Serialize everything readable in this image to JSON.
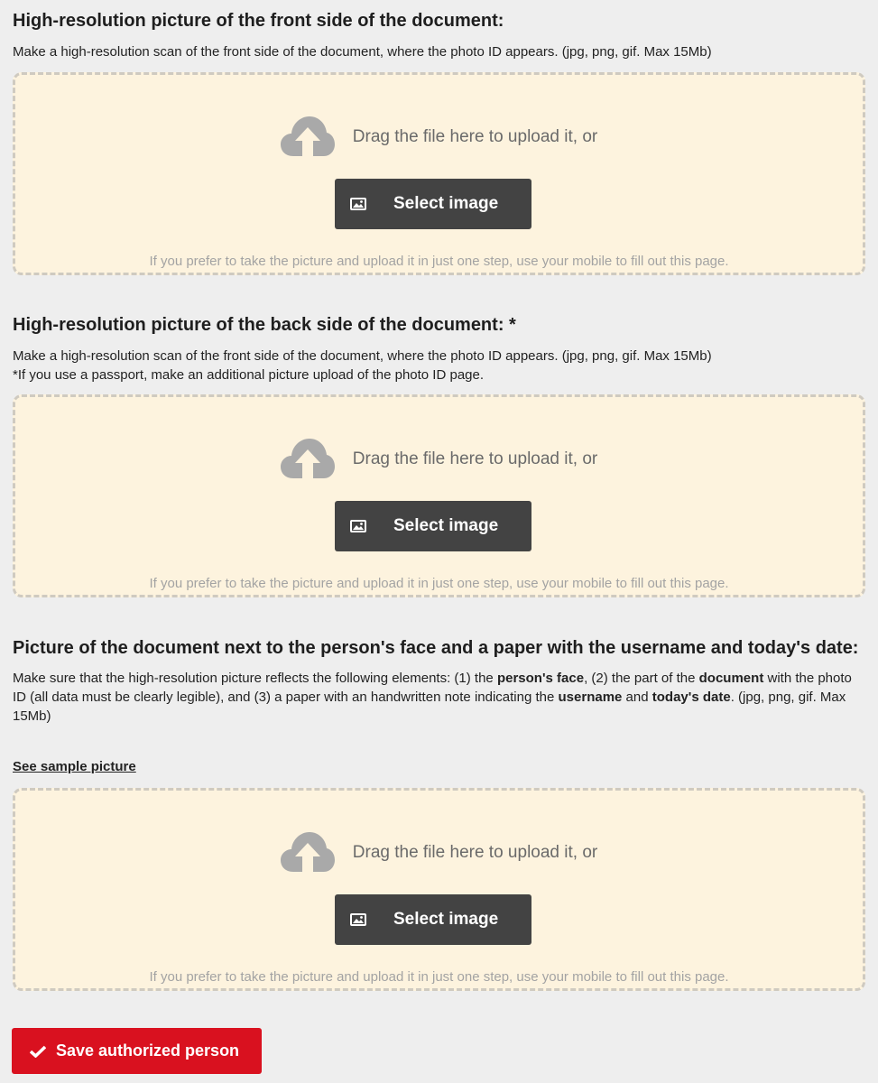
{
  "sections": [
    {
      "title": "High-resolution picture of the front side of the document:",
      "desc": "Make a high-resolution scan of the front side of the document, where the photo ID appears. (jpg, png, gif. Max 15Mb)"
    },
    {
      "title": "High-resolution picture of the back side of the document: *",
      "desc": "Make a high-resolution scan of the front side of the document, where the photo ID appears. (jpg, png, gif. Max 15Mb)",
      "note": "*If you use a passport, make an additional picture upload of the photo ID page."
    },
    {
      "title": "Picture of the document next to the person's face and a paper with the username and today's date:",
      "desc_parts": [
        {
          "text": "Make sure that the high-resolution picture reflects the following elements: (1) the ",
          "bold": false
        },
        {
          "text": "person's face",
          "bold": true
        },
        {
          "text": ", (2) the part of the ",
          "bold": false
        },
        {
          "text": "document",
          "bold": true
        },
        {
          "text": " with the photo ID (all data must be clearly legible), and (3) a paper with an handwritten note indicating the ",
          "bold": false
        },
        {
          "text": "username",
          "bold": true
        },
        {
          "text": " and ",
          "bold": false
        },
        {
          "text": "today's date",
          "bold": true
        },
        {
          "text": ". (jpg, png, gif. Max 15Mb)",
          "bold": false
        }
      ],
      "sample_link": "See sample picture"
    }
  ],
  "dropzone": {
    "drag_text": "Drag the file here to upload it, or",
    "button_label": "Select image",
    "hint": "If you prefer to take the picture and upload it in just one step, use your mobile to fill out this page.",
    "icon": "cloud-upload-icon",
    "button_icon": "image-icon"
  },
  "save": {
    "label": "Save authorized person",
    "icon": "check-icon"
  },
  "colors": {
    "background": "#eeeeee",
    "dropzone_bg": "#fdf3de",
    "dropzone_border": "#cfcac0",
    "select_button": "#434343",
    "save_button": "#d9111f",
    "hint_text": "#a3a3a3"
  }
}
